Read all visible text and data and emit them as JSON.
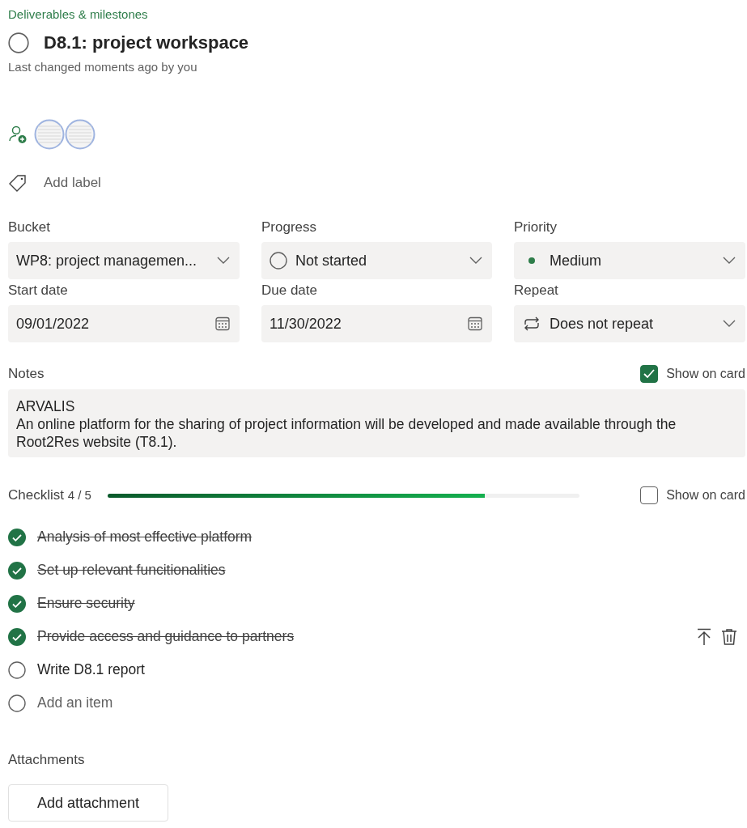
{
  "breadcrumb": "Deliverables & milestones",
  "task": {
    "title": "D8.1: project workspace",
    "completed": false,
    "subtitle": "Last changed moments ago by you"
  },
  "assignees": [
    {
      "kind": "avatar"
    },
    {
      "kind": "avatar"
    }
  ],
  "label_button": "Add label",
  "fields": [
    {
      "label": "Bucket",
      "kind": "select",
      "value": "WP8: project managemen..."
    },
    {
      "label": "Progress",
      "kind": "progress",
      "value": "Not started"
    },
    {
      "label": "Priority",
      "kind": "priority",
      "value": "Medium",
      "color": "#2e7d4a"
    },
    {
      "label": "Start date",
      "kind": "date",
      "value": "09/01/2022"
    },
    {
      "label": "Due date",
      "kind": "date",
      "value": "11/30/2022"
    },
    {
      "label": "Repeat",
      "kind": "repeat",
      "value": "Does not repeat"
    }
  ],
  "notes": {
    "label": "Notes",
    "show_on_card": {
      "label": "Show on card",
      "checked": true
    },
    "lines": [
      "ARVALIS",
      "An online platform for the sharing of project information will be developed and made available through the Root2Res website (T8.1)."
    ]
  },
  "checklist": {
    "label": "Checklist",
    "count": "4 / 5",
    "level": 0.8,
    "show_on_card": {
      "label": "Show on card",
      "checked": false
    },
    "items": [
      {
        "text": "Analysis of most effective platform",
        "completed": true,
        "hovered": false
      },
      {
        "text": "Set up relevant funcitionalities",
        "completed": true,
        "hovered": false
      },
      {
        "text": "Ensure security",
        "completed": true,
        "hovered": false
      },
      {
        "text": "Provide access and guidance to partners",
        "completed": true,
        "hovered": true
      },
      {
        "text": "Write D8.1 report",
        "completed": false,
        "hovered": false
      }
    ],
    "new_item": {
      "placeholder": "Add an item"
    }
  },
  "attachments": {
    "label": "Attachments",
    "button": "Add attachment"
  }
}
